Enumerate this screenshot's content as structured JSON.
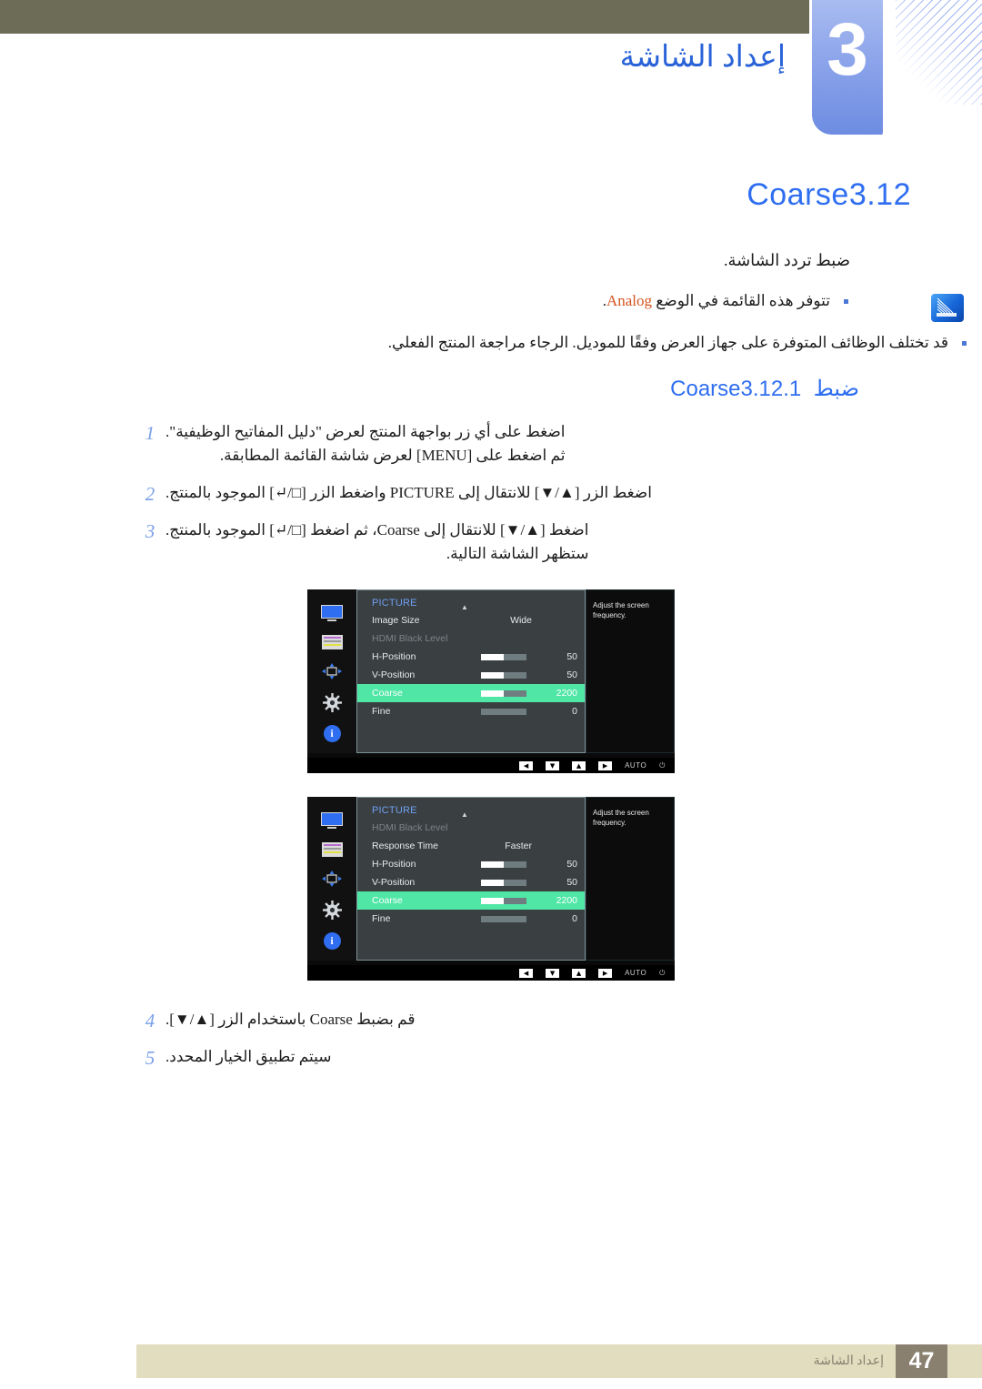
{
  "header": {
    "chapter_number": "3",
    "chapter_title": "إعداد الشاشة"
  },
  "section": {
    "number": "3.12",
    "title": "Coarse",
    "lead": "ضبط تردد الشاشة."
  },
  "notes": {
    "icon_name": "samsung-note-icon",
    "items": [
      {
        "text_before": "تتوفر هذه القائمة في الوضع ",
        "highlight": "Analog",
        "text_after": "."
      },
      {
        "text_before": "قد تختلف الوظائف المتوفرة على جهاز العرض وفقًا للموديل. الرجاء مراجعة المنتج الفعلي.",
        "highlight": "",
        "text_after": ""
      }
    ]
  },
  "subsection": {
    "number": "3.12.1",
    "title_ar": "ضبط",
    "title_en": "Coarse"
  },
  "steps": [
    {
      "num": "1",
      "line1": "اضغط على أي زر بواجهة المنتج لعرض \"دليل المفاتيح الوظيفية\".",
      "line2": "ثم اضغط على [MENU] لعرض شاشة القائمة المطابقة."
    },
    {
      "num": "2",
      "line1": "اضغط الزر [▲/▼] للانتقال إلى PICTURE واضغط الزر [□/↵] الموجود بالمنتج.",
      "line2": ""
    },
    {
      "num": "3",
      "line1": "اضغط [▲/▼] للانتقال إلى Coarse، ثم اضغط [□/↵] الموجود بالمنتج.",
      "line2": "ستظهر الشاشة التالية."
    },
    {
      "num": "4",
      "line1": "قم بضبط Coarse باستخدام الزر [▲/▼].",
      "line2": ""
    },
    {
      "num": "5",
      "line1": "سيتم تطبيق الخيار المحدد.",
      "line2": ""
    }
  ],
  "osd": {
    "help_text": "Adjust the screen frequency.",
    "category": "PICTURE",
    "caret": "▲",
    "side_icons": [
      "monitor-icon",
      "picture-list-icon",
      "position-move-icon",
      "gear-icon",
      "info-icon"
    ],
    "bottom_bar": {
      "buttons": [
        "◀",
        "▼",
        "▲",
        "▶"
      ],
      "auto_label": "AUTO",
      "power_label": "⏻"
    },
    "screen1": {
      "rows": [
        {
          "label": "Image Size",
          "value": "Wide",
          "type": "value",
          "dim": false,
          "highlight": false
        },
        {
          "label": "HDMI Black Level",
          "value": "",
          "type": "none",
          "dim": true,
          "highlight": false
        },
        {
          "label": "H-Position",
          "value": "50",
          "type": "slider",
          "fill": 50,
          "dim": false,
          "highlight": false
        },
        {
          "label": "V-Position",
          "value": "50",
          "type": "slider",
          "fill": 50,
          "dim": false,
          "highlight": false
        },
        {
          "label": "Coarse",
          "value": "2200",
          "type": "slider",
          "fill": 50,
          "dim": false,
          "highlight": true
        },
        {
          "label": "Fine",
          "value": "0",
          "type": "slider",
          "fill": 0,
          "dim": false,
          "highlight": false
        }
      ]
    },
    "screen2": {
      "rows": [
        {
          "label": "HDMI Black Level",
          "value": "",
          "type": "none",
          "dim": true,
          "highlight": false
        },
        {
          "label": "Response Time",
          "value": "Faster",
          "type": "value",
          "dim": false,
          "highlight": false
        },
        {
          "label": "H-Position",
          "value": "50",
          "type": "slider",
          "fill": 50,
          "dim": false,
          "highlight": false
        },
        {
          "label": "V-Position",
          "value": "50",
          "type": "slider",
          "fill": 50,
          "dim": false,
          "highlight": false
        },
        {
          "label": "Coarse",
          "value": "2200",
          "type": "slider",
          "fill": 50,
          "dim": false,
          "highlight": true
        },
        {
          "label": "Fine",
          "value": "0",
          "type": "slider",
          "fill": 0,
          "dim": false,
          "highlight": false
        }
      ]
    }
  },
  "footer": {
    "page_number": "47",
    "text": "إعداد الشاشة"
  },
  "colors": {
    "accent_blue": "#2f6ef0",
    "olive": "#6d6c57",
    "footer_band": "#e3ddc0",
    "page_box": "#8a8070",
    "highlight_green": "#4fe6a6",
    "orange": "#d4541c"
  }
}
